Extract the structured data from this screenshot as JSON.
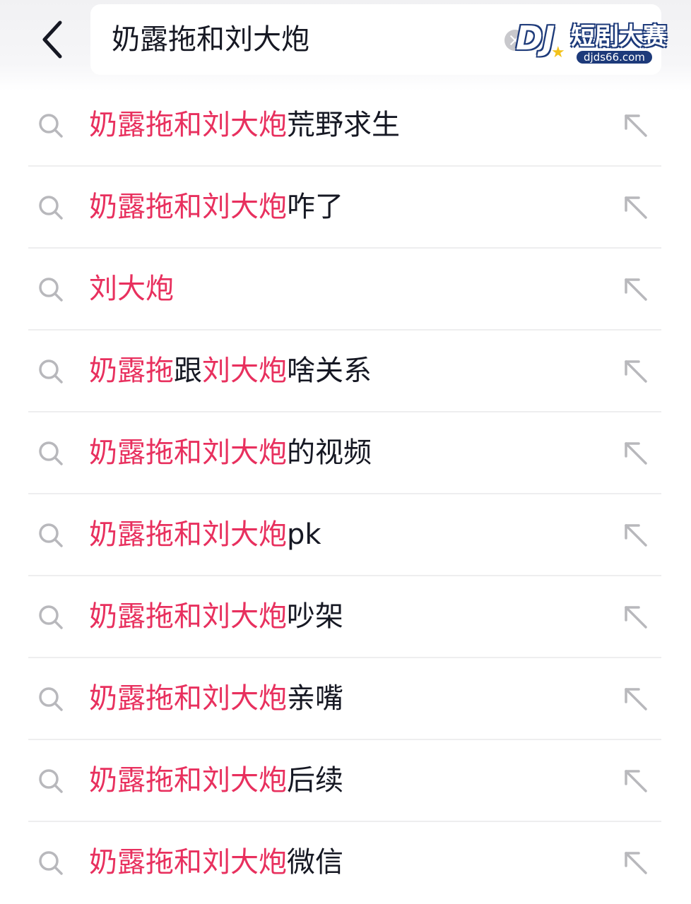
{
  "search": {
    "query": "奶露拖和刘大炮"
  },
  "watermark": {
    "logo": "DJ",
    "title": "短剧大赛",
    "url": "djds66.com"
  },
  "colors": {
    "highlight": "#e8305e",
    "text": "#161823",
    "icon": "#b8b8bc"
  },
  "icons": {
    "back": "chevron-left-icon",
    "clear": "clear-icon",
    "search": "search-icon",
    "fill": "arrow-up-left-icon"
  },
  "suggestions": [
    {
      "parts": [
        {
          "text": "奶露拖和刘大炮",
          "hl": true
        },
        {
          "text": "荒野求生",
          "hl": false
        }
      ]
    },
    {
      "parts": [
        {
          "text": "奶露拖和刘大炮",
          "hl": true
        },
        {
          "text": "咋了",
          "hl": false
        }
      ]
    },
    {
      "parts": [
        {
          "text": "刘大炮",
          "hl": true
        }
      ]
    },
    {
      "parts": [
        {
          "text": "奶露拖",
          "hl": true
        },
        {
          "text": "跟",
          "hl": false
        },
        {
          "text": "刘大炮",
          "hl": true
        },
        {
          "text": "啥关系",
          "hl": false
        }
      ]
    },
    {
      "parts": [
        {
          "text": "奶露拖和刘大炮",
          "hl": true
        },
        {
          "text": "的视频",
          "hl": false
        }
      ]
    },
    {
      "parts": [
        {
          "text": "奶露拖和刘大炮",
          "hl": true
        },
        {
          "text": "pk",
          "hl": false
        }
      ]
    },
    {
      "parts": [
        {
          "text": "奶露拖和刘大炮",
          "hl": true
        },
        {
          "text": "吵架",
          "hl": false
        }
      ]
    },
    {
      "parts": [
        {
          "text": "奶露拖和刘大炮",
          "hl": true
        },
        {
          "text": "亲嘴",
          "hl": false
        }
      ]
    },
    {
      "parts": [
        {
          "text": "奶露拖和刘大炮",
          "hl": true
        },
        {
          "text": "后续",
          "hl": false
        }
      ]
    },
    {
      "parts": [
        {
          "text": "奶露拖和刘大炮",
          "hl": true
        },
        {
          "text": "微信",
          "hl": false
        }
      ]
    }
  ]
}
